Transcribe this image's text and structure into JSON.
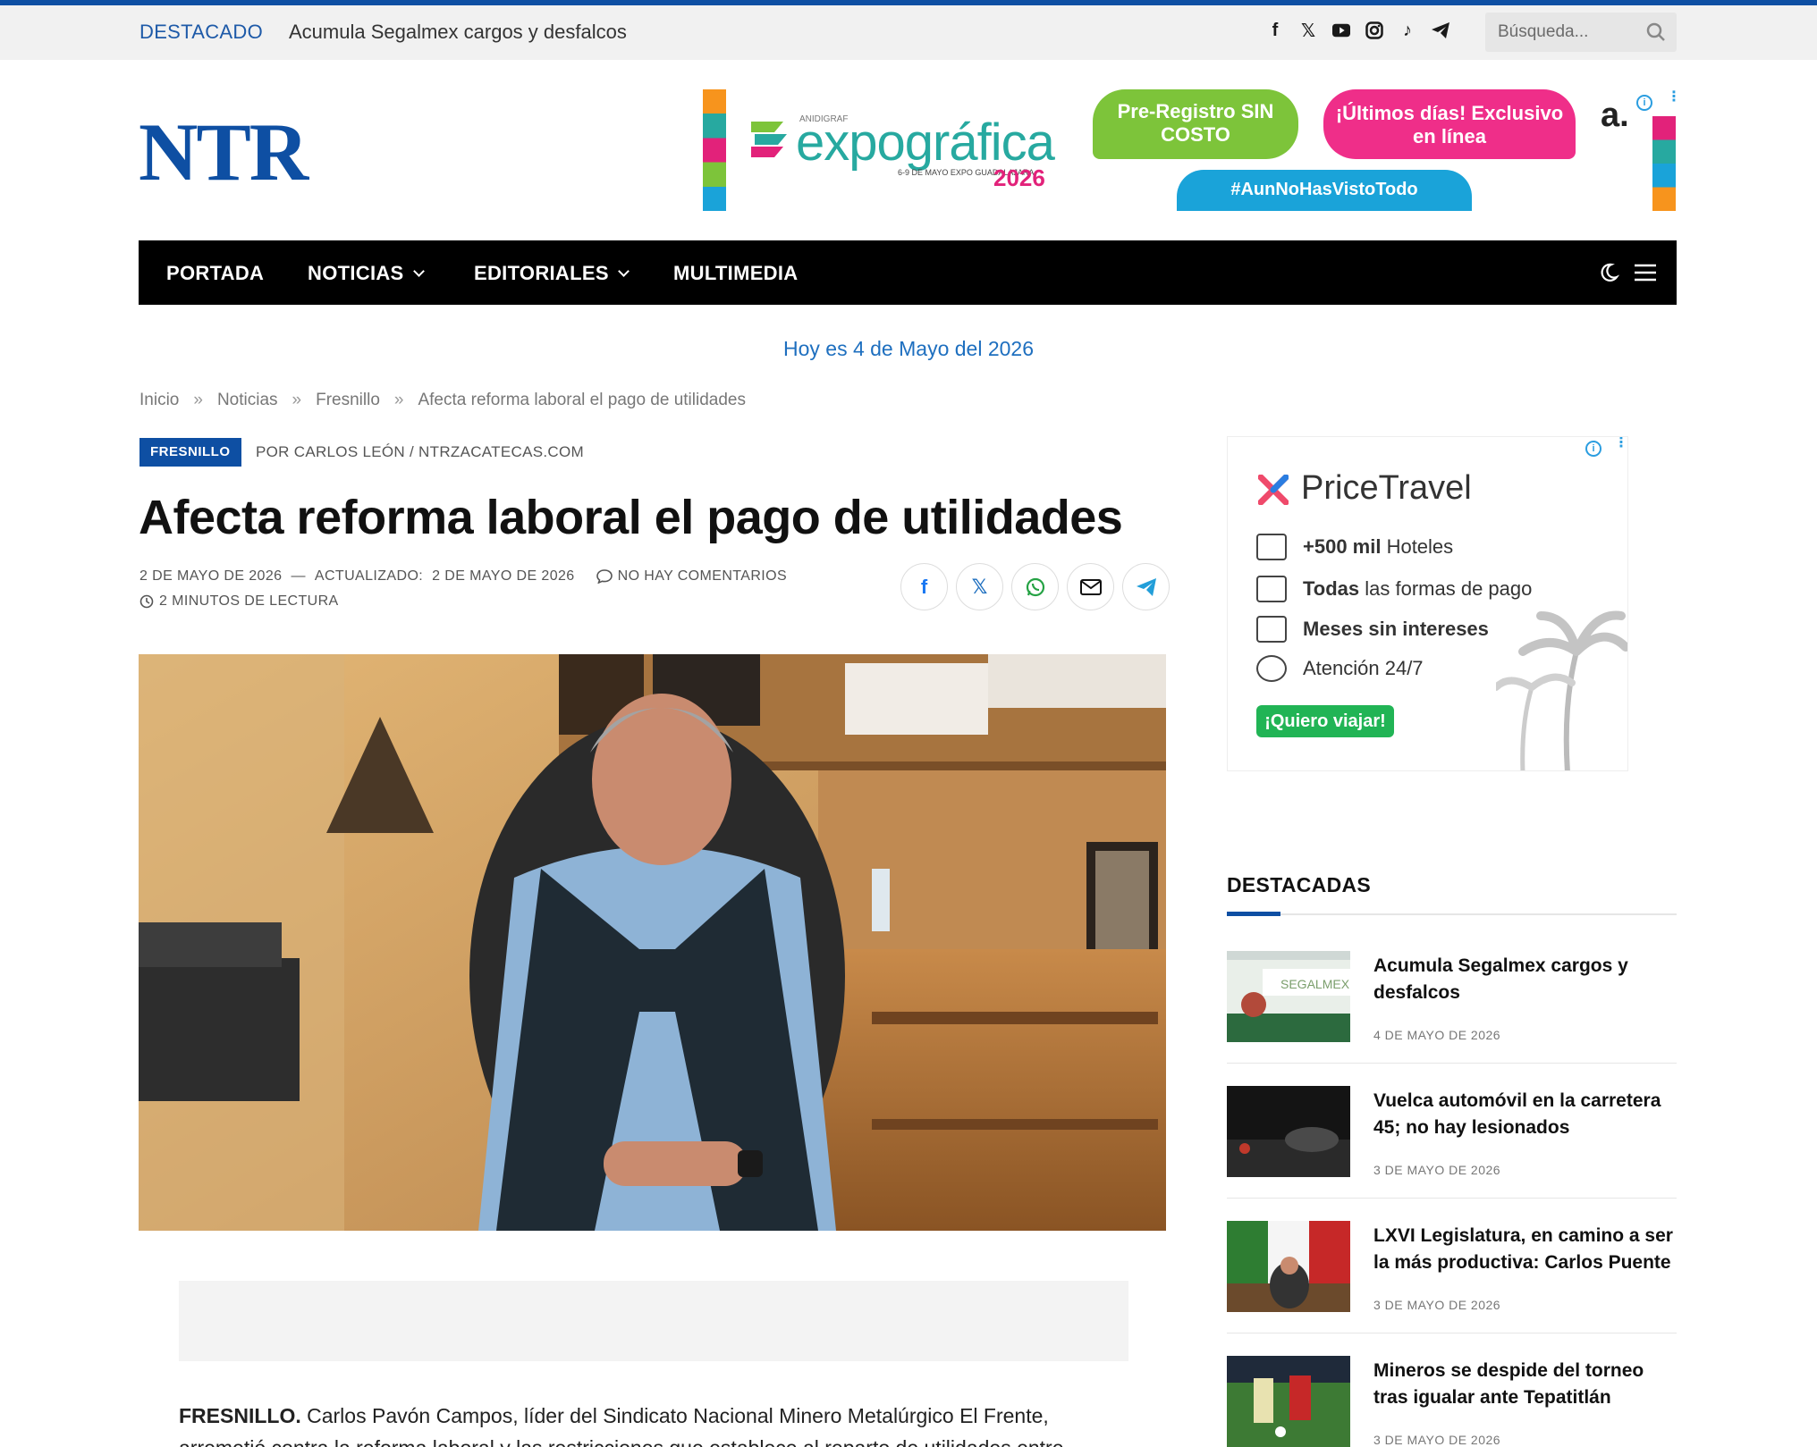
{
  "topbar": {
    "destacado_label": "DESTACADO",
    "headline": "Acumula Segalmex cargos y desfalcos",
    "socials": [
      "facebook-icon",
      "x-icon",
      "youtube-icon",
      "instagram-icon",
      "tiktok-icon",
      "telegram-icon"
    ],
    "search_placeholder": "Búsqueda..."
  },
  "logo": "NTR",
  "header_ad": {
    "brand_small": "ANIDIGRAF",
    "brand": "expográfica",
    "dates": "6-9 DE MAYO EXPO GUADALAJARA",
    "year": "2026",
    "bubble1": "Pre-Registro SIN COSTO",
    "bubble2": "¡Últimos días! Exclusivo en línea",
    "hashtag": "#AunNoHasVistoTodo"
  },
  "nav": {
    "items": [
      {
        "label": "PORTADA",
        "dropdown": false
      },
      {
        "label": "NOTICIAS",
        "dropdown": true
      },
      {
        "label": "EDITORIALES",
        "dropdown": true
      },
      {
        "label": "MULTIMEDIA",
        "dropdown": false
      }
    ]
  },
  "today": "Hoy es 4 de Mayo del 2026",
  "breadcrumb": [
    "Inicio",
    "Noticias",
    "Fresnillo",
    "Afecta reforma laboral el pago de utilidades"
  ],
  "breadcrumb_sep": "»",
  "article": {
    "category": "FRESNILLO",
    "byline": "POR CARLOS LEÓN / NTRZACATECAS.COM",
    "title": "Afecta reforma laboral el pago de utilidades",
    "date": "2 DE MAYO DE 2026",
    "dash": "—",
    "updated_label": "ACTUALIZADO:",
    "updated_date": "2 DE MAYO DE 2026",
    "comments": "NO HAY COMENTARIOS",
    "read_time": "2 MINUTOS DE LECTURA",
    "lead_strong": "FRESNILLO.",
    "lead_text": " Carlos Pavón Campos, líder del Sindicato Nacional Minero Metalúrgico El Frente, arremetió contra la reforma laboral y las restricciones que establece al reparto de utilidades entre"
  },
  "share": [
    "facebook-icon",
    "x-icon",
    "whatsapp-icon",
    "email-icon",
    "telegram-icon"
  ],
  "side_ad": {
    "brand": "PriceTravel",
    "rows": [
      {
        "bold": "+500 mil",
        "text": " Hoteles"
      },
      {
        "bold": "Todas",
        "text": " las formas de pago"
      },
      {
        "bold": "Meses sin intereses",
        "text": ""
      },
      {
        "bold": "",
        "text": "Atención 24/7"
      }
    ],
    "cta": "¡Quiero viajar!"
  },
  "sidebar": {
    "title": "DESTACADAS",
    "items": [
      {
        "title": "Acumula Segalmex cargos y desfalcos",
        "date": "4 DE MAYO DE 2026"
      },
      {
        "title": "Vuelca automóvil en la carretera 45; no hay lesionados",
        "date": "3 DE MAYO DE 2026"
      },
      {
        "title": "LXVI Legislatura, en camino a ser la más productiva: Carlos Puente",
        "date": "3 DE MAYO DE 2026"
      },
      {
        "title": "Mineros se despide del torneo tras igualar ante Tepatitlán",
        "date": "3 DE MAYO DE 2026"
      }
    ]
  },
  "colors": {
    "brand_blue": "#0e4fa3",
    "nav_bg": "#000000",
    "link_blue": "#1e6fbf"
  }
}
